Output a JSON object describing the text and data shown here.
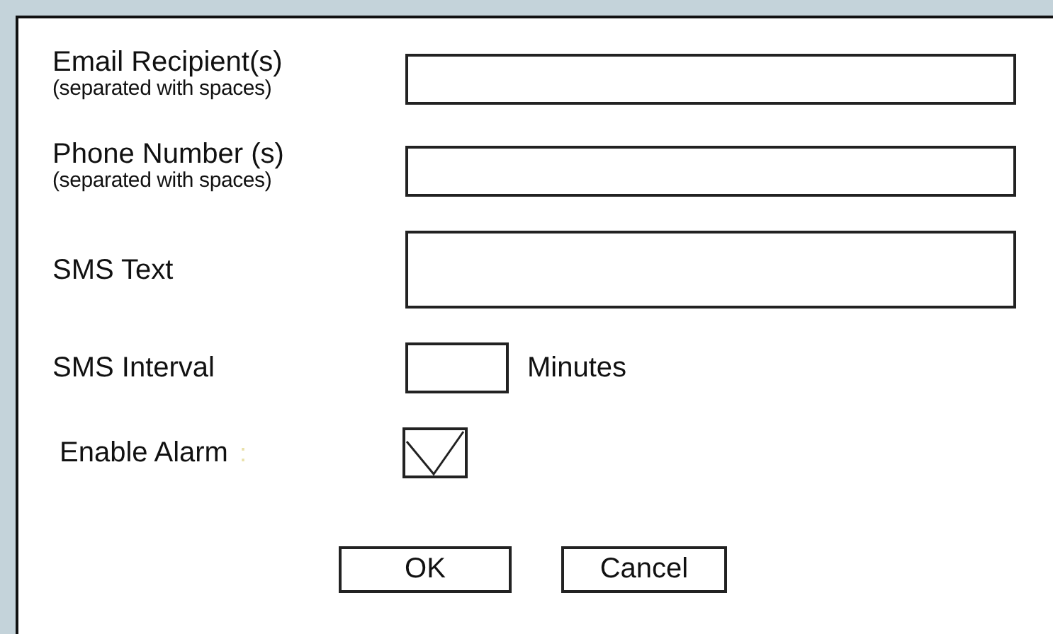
{
  "fields": [
    {
      "kind": "input",
      "label": "Email Recipient(s)",
      "hint": "(separated with spaces)"
    },
    {
      "kind": "input",
      "label": "Phone Number (s)",
      "hint": "(separated with spaces)"
    },
    {
      "kind": "textarea",
      "label": "SMS Text"
    },
    {
      "kind": "input_unit",
      "label": "SMS Interval",
      "unit": "Minutes"
    },
    {
      "kind": "checkbox",
      "label": "Enable Alarm",
      "separator": ":",
      "checked": true
    }
  ],
  "buttons": [
    {
      "label": "OK"
    },
    {
      "label": "Cancel"
    }
  ]
}
